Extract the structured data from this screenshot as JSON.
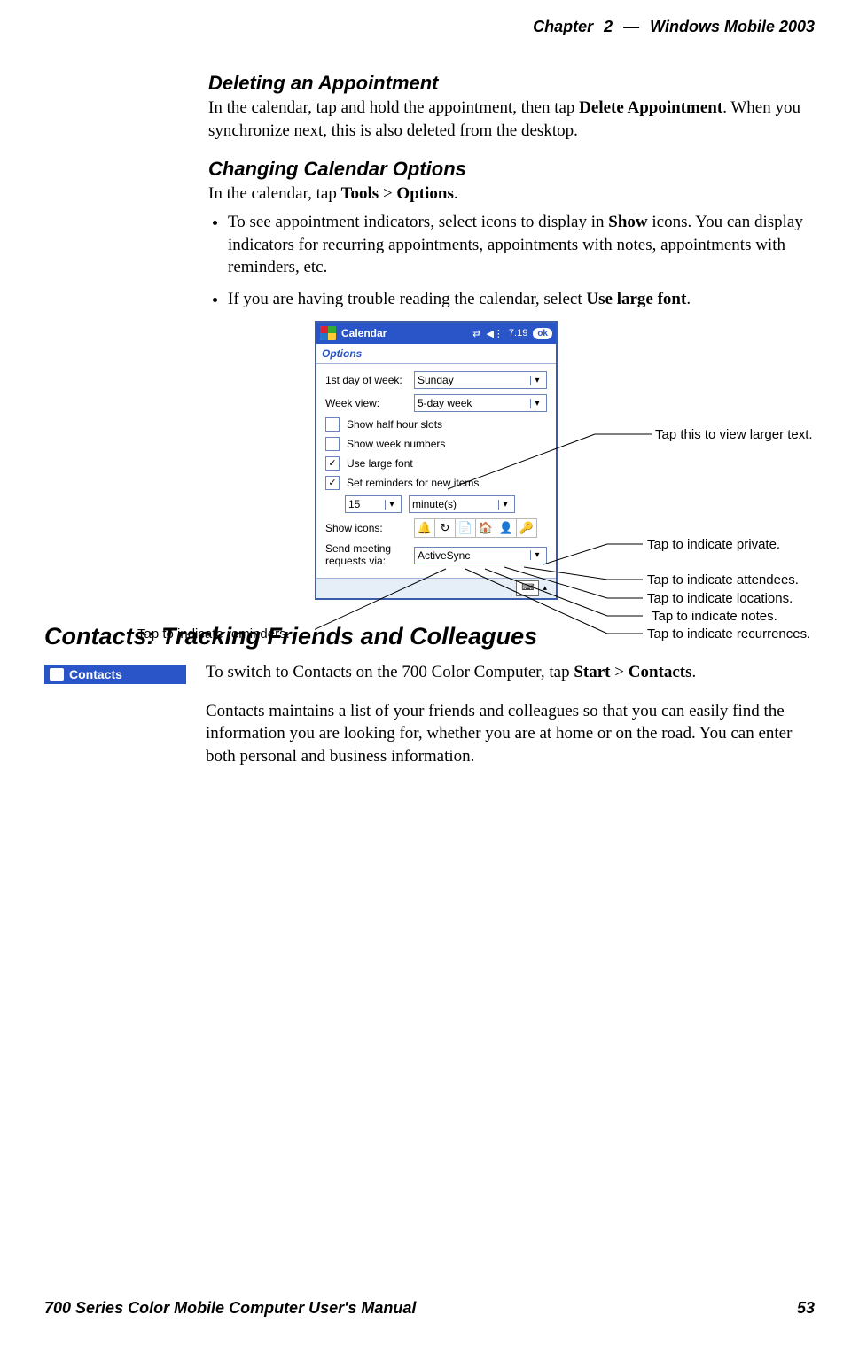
{
  "header": {
    "chapter": "Chapter",
    "num": "2",
    "sep": "—",
    "title": "Windows Mobile 2003"
  },
  "h_del": "Deleting an Appointment",
  "p_del_a": "In the calendar, tap and hold the appointment, then tap ",
  "p_del_b": "Delete Appointment",
  "p_del_c": ". When you synchronize next, this is also deleted from the desktop.",
  "h_chg": "Changing Calendar Options",
  "p_chg_a": "In the calendar, tap ",
  "p_chg_b": "Tools",
  "p_chg_c": " > ",
  "p_chg_d": "Options",
  "p_chg_e": ".",
  "li1_a": "To see appointment indicators, select icons to display in ",
  "li1_b": "Show",
  "li1_c": " icons. You can display indicators for recurring appointments, appointments with notes, appointments with reminders, etc.",
  "li2_a": "If you are having trouble reading the calendar, select ",
  "li2_b": "Use large font",
  "li2_c": ".",
  "shot": {
    "title": "Calendar",
    "time": "7:19",
    "ok": "ok",
    "sub": "Options",
    "l_dow": "1st day of week:",
    "v_dow": "Sunday",
    "l_wk": "Week view:",
    "v_wk": "5-day week",
    "cb1": "Show half hour slots",
    "cb2": "Show week numbers",
    "cb3": "Use large font",
    "cb4": "Set reminders for new items",
    "rem_n": "15",
    "rem_u": "minute(s)",
    "l_icons": "Show icons:",
    "icons": {
      "bell": "🔔",
      "cycle": "↻",
      "note": "📄",
      "house": "🏠",
      "person": "👤",
      "key": "🔑"
    },
    "l_send": "Send meeting requests via:",
    "v_send": "ActiveSync"
  },
  "callouts": {
    "larger": "Tap this to view larger text.",
    "private": "Tap to indicate private.",
    "attendees": "Tap to indicate attendees.",
    "locations": "Tap to indicate locations.",
    "notes": "Tap to indicate notes.",
    "recurrences": "Tap to indicate recurrences.",
    "reminders": "Tap to indicate reminders."
  },
  "h_contacts": "Contacts: Tracking Friends and Colleagues",
  "badge": "Contacts",
  "p_con1_a": "To switch to Contacts on the 700 Color Computer, tap ",
  "p_con1_b": "Start",
  "p_con1_c": " > ",
  "p_con1_d": "Contacts",
  "p_con1_e": ".",
  "p_con2": "Contacts maintains a list of your friends and colleagues so that you can easily find the information you are looking for, whether you are at home or on the road. You can enter both personal and business information.",
  "footer": {
    "l": "700 Series Color Mobile Computer User's Manual",
    "r": "53"
  }
}
